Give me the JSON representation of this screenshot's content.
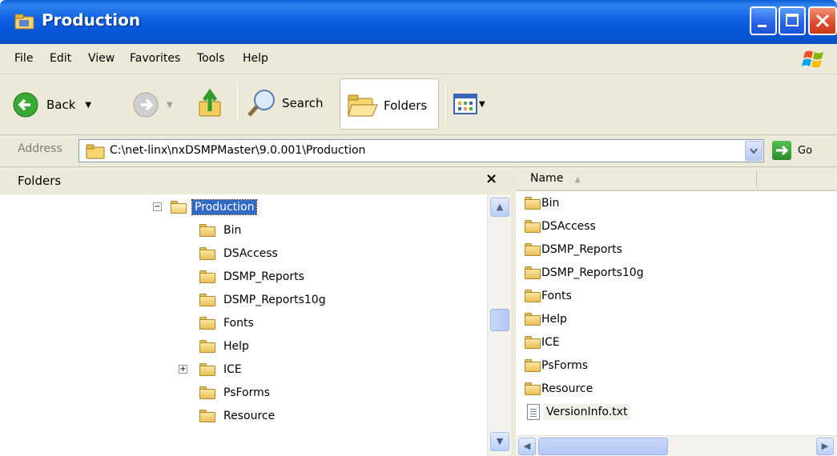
{
  "window": {
    "title": "Production"
  },
  "menu": {
    "items": [
      "File",
      "Edit",
      "View",
      "Favorites",
      "Tools",
      "Help"
    ]
  },
  "toolbar": {
    "back_label": "Back",
    "search_label": "Search",
    "folders_label": "Folders"
  },
  "address": {
    "label": "Address",
    "value": "C:\\net-linx\\nxDSMPMaster\\9.0.001\\Production",
    "go_label": "Go"
  },
  "folders_pane": {
    "title": "Folders",
    "close_glyph": "×",
    "tree": [
      {
        "label": "Production",
        "expander": "−",
        "selected": true
      },
      {
        "label": "Bin"
      },
      {
        "label": "DSAccess"
      },
      {
        "label": "DSMP_Reports"
      },
      {
        "label": "DSMP_Reports10g"
      },
      {
        "label": "Fonts"
      },
      {
        "label": "Help"
      },
      {
        "label": "ICE",
        "expander": "+"
      },
      {
        "label": "PsForms"
      },
      {
        "label": "Resource"
      }
    ]
  },
  "files_pane": {
    "column_name": "Name",
    "items": [
      {
        "label": "Bin",
        "type": "folder"
      },
      {
        "label": "DSAccess",
        "type": "folder"
      },
      {
        "label": "DSMP_Reports",
        "type": "folder"
      },
      {
        "label": "DSMP_Reports10g",
        "type": "folder"
      },
      {
        "label": "Fonts",
        "type": "folder"
      },
      {
        "label": "Help",
        "type": "folder"
      },
      {
        "label": "ICE",
        "type": "folder"
      },
      {
        "label": "PsForms",
        "type": "folder"
      },
      {
        "label": "Resource",
        "type": "folder"
      },
      {
        "label": "VersionInfo.txt",
        "type": "file"
      }
    ]
  },
  "colors": {
    "titlebar": "#0a5fd8",
    "chrome": "#ece9d8",
    "selection": "#316ac5"
  }
}
